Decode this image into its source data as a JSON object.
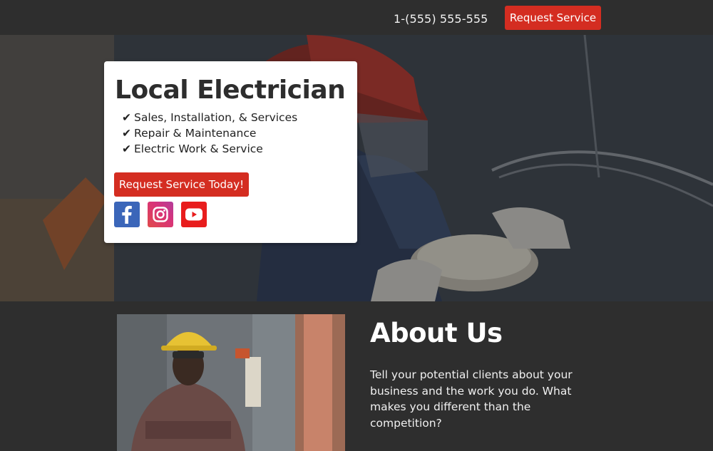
{
  "header": {
    "phone": "1-(555) 555-555",
    "request_button": "Request Service"
  },
  "hero": {
    "title": "Local Electrician",
    "features": [
      {
        "check": "✔",
        "text": "Sales, Installation, & Services"
      },
      {
        "check": "✔",
        "text": "Repair & Maintenance"
      },
      {
        "check": "✔",
        "text": "Electric Work & Service"
      }
    ],
    "cta_button": "Request Service Today!",
    "social": [
      "facebook-icon",
      "instagram-icon",
      "youtube-icon"
    ]
  },
  "about": {
    "title": "About Us",
    "body": "Tell your potential clients about your business and the work you do. What makes you different than the competition?"
  },
  "colors": {
    "accent": "#d42d21",
    "dark": "#2e2e2e",
    "facebook": "#3b66b9",
    "youtube": "#e81d1d"
  }
}
